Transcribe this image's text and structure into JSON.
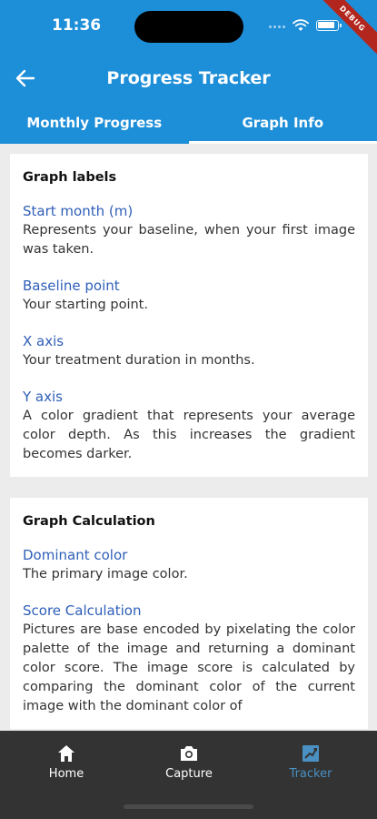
{
  "status_bar": {
    "time": "11:36",
    "debug_label": "DEBUG"
  },
  "header": {
    "title": "Progress Tracker"
  },
  "tabs": [
    {
      "label": "Monthly Progress",
      "active": false
    },
    {
      "label": "Graph Info",
      "active": true
    }
  ],
  "graph_labels": {
    "title": "Graph labels",
    "items": [
      {
        "title": "Start month (m)",
        "desc": "Represents your baseline, when your first image was taken."
      },
      {
        "title": "Baseline point",
        "desc": "Your starting point."
      },
      {
        "title": "X axis",
        "desc": "Your treatment duration in months."
      },
      {
        "title": "Y axis",
        "desc": "A color gradient that represents your average color depth. As this increases the gradient becomes darker."
      }
    ]
  },
  "graph_calculation": {
    "title": "Graph Calculation",
    "items": [
      {
        "title": "Dominant color",
        "desc": "The primary image color."
      },
      {
        "title": "Score Calculation",
        "desc": "Pictures are base encoded by pixelating the color palette of the image and returning a dominant color score. The image score is calculated by comparing the dominant color of the current image with the dominant color of"
      }
    ]
  },
  "bottom_nav": {
    "items": [
      {
        "label": "Home",
        "icon": "home-icon",
        "active": false
      },
      {
        "label": "Capture",
        "icon": "camera-icon",
        "active": false
      },
      {
        "label": "Tracker",
        "icon": "tracker-icon",
        "active": true
      }
    ]
  },
  "colors": {
    "header": "#1d8ed8",
    "link_title": "#2f5fb8",
    "nav_bg": "#333333",
    "nav_active": "#4a90c2"
  }
}
